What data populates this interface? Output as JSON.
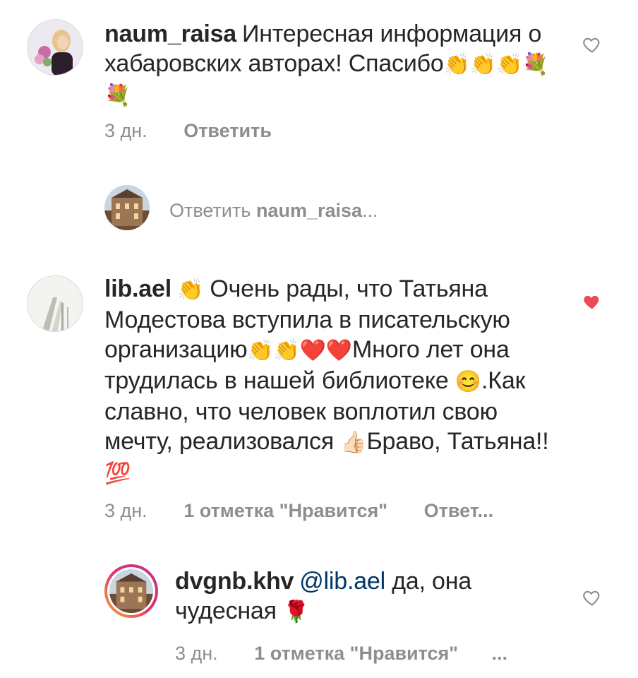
{
  "comments": [
    {
      "username": "naum_raisa",
      "text": "Интересная информация о хабаровских авторах! Спасибо",
      "emojis": "👏👏👏💐💐",
      "time": "3 дн.",
      "reply_label": "Ответить",
      "liked": false
    },
    {
      "username": "lib.ael",
      "text_parts": [
        "Очень рады, что Татьяна Модестова вступила в писательскую организацию",
        "Много лет она трудилась в нашей библиотеке",
        ".Как славно, что человек воплотил свою мечту, реализовался",
        "Браво, Татьяна!!"
      ],
      "emoji_a": "👏",
      "emoji_b": "👏👏❤️❤️",
      "emoji_c": "😊",
      "emoji_d": "👍🏻",
      "emoji_e": "💯",
      "time": "3 дн.",
      "likes_label": "1 отметка \"Нравится\"",
      "reply_label": "Ответ...",
      "liked": true
    },
    {
      "username": "dvgnb.khv",
      "mention": "@lib.ael",
      "text": "да, она чудесная",
      "emoji": "🌹",
      "time": "3 дн.",
      "likes_label": "1 отметка \"Нравится\"",
      "more_label": "...",
      "liked": false
    }
  ],
  "reply_field": {
    "prefix": "Ответить",
    "target": "naum_raisa",
    "suffix": "..."
  },
  "colors": {
    "text": "#262626",
    "meta": "#8e8e8e",
    "heart_liked": "#ed4956",
    "mention": "#003569"
  }
}
